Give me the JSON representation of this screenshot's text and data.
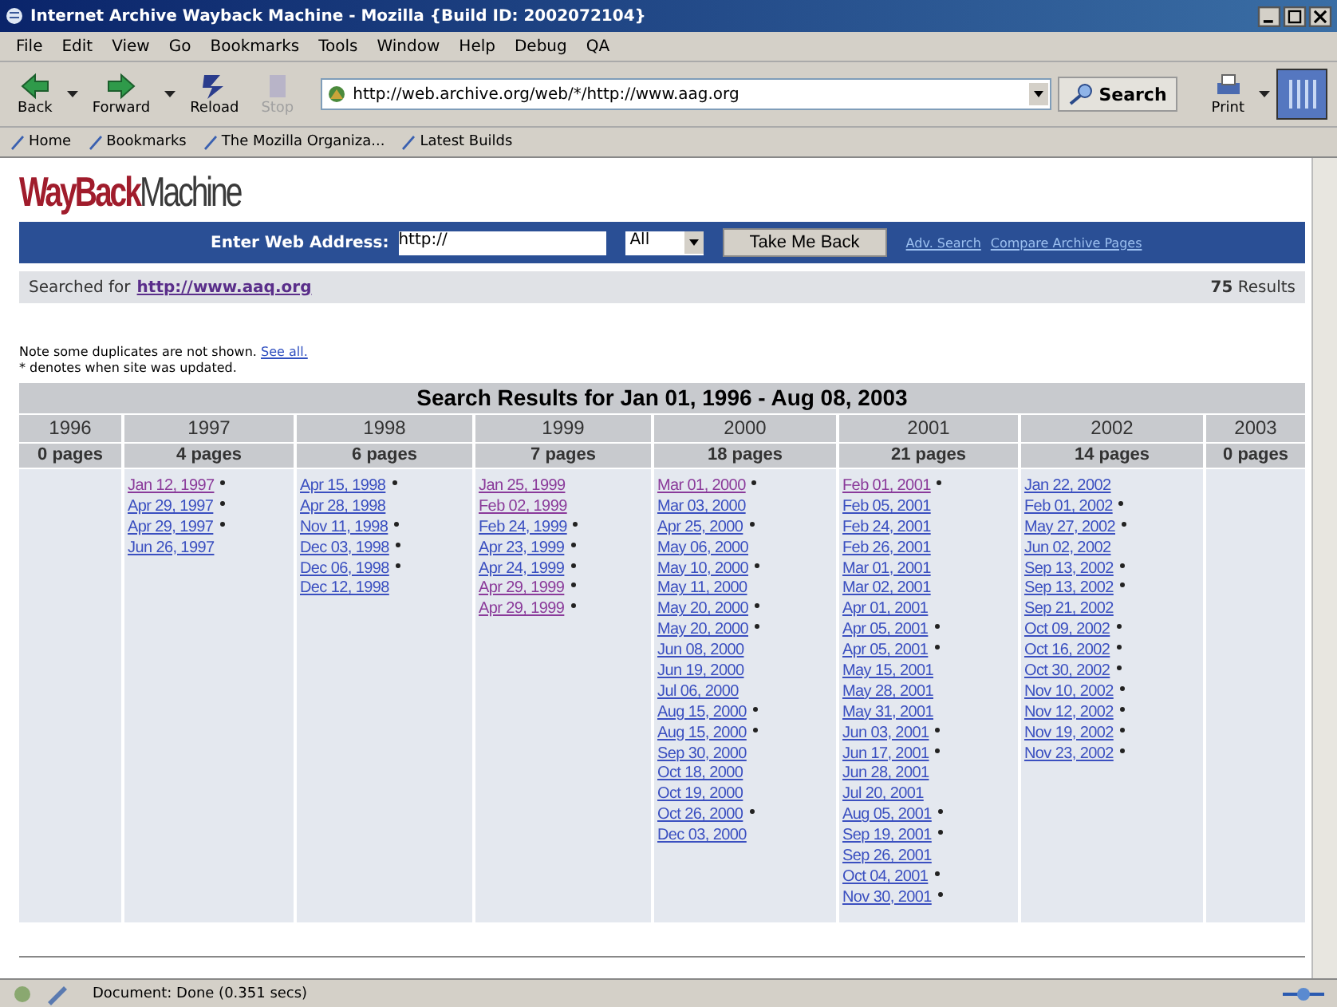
{
  "window": {
    "title": "Internet Archive Wayback Machine - Mozilla {Build ID: 2002072104}"
  },
  "menu": [
    "File",
    "Edit",
    "View",
    "Go",
    "Bookmarks",
    "Tools",
    "Window",
    "Help",
    "Debug",
    "QA"
  ],
  "toolbar": [
    {
      "label": "Back",
      "kind": "back",
      "disabled": false,
      "dropdown": true
    },
    {
      "label": "Forward",
      "kind": "forward",
      "disabled": false,
      "dropdown": true
    },
    {
      "label": "Reload",
      "kind": "reload",
      "disabled": false,
      "dropdown": false
    },
    {
      "label": "Stop",
      "kind": "stop",
      "disabled": true,
      "dropdown": false
    }
  ],
  "address": {
    "value": "http://web.archive.org/web/*/http://www.aag.org"
  },
  "search_button": "Search",
  "print_button": "Print",
  "bookmarks": [
    "Home",
    "Bookmarks",
    "The Mozilla Organiza...",
    "Latest Builds"
  ],
  "page": {
    "logo": {
      "first": "WayBack",
      "second": "Machine"
    },
    "form": {
      "label": "Enter Web Address:",
      "value": "http://",
      "select": "All",
      "button": "Take Me Back",
      "links": [
        "Adv. Search",
        "Compare Archive Pages"
      ]
    },
    "searched": {
      "prefix": "Searched for",
      "url": "http://www.aaq.org",
      "count": "75",
      "suffix": "Results"
    },
    "note": {
      "text": "Note some duplicates are not shown.",
      "link": "See all.",
      "legend": "* denotes when site was updated."
    },
    "results": {
      "title": "Search Results for Jan 01, 1996 - Aug 08, 2003",
      "years": [
        {
          "year": "1996",
          "pages": "0 pages"
        },
        {
          "year": "1997",
          "pages": "4 pages",
          "captures": [
            {
              "date": "Jan 12, 1997",
              "updated": true,
              "visited": true
            },
            {
              "date": "Apr 29, 1997",
              "updated": true,
              "visited": false
            },
            {
              "date": "Apr 29, 1997",
              "updated": true,
              "visited": false
            },
            {
              "date": "Jun 26, 1997",
              "updated": false,
              "visited": false
            }
          ]
        },
        {
          "year": "1998",
          "pages": "6 pages",
          "captures": [
            {
              "date": "Apr 15, 1998",
              "updated": true,
              "visited": false
            },
            {
              "date": "Apr 28, 1998",
              "updated": false,
              "visited": false
            },
            {
              "date": "Nov 11, 1998",
              "updated": true,
              "visited": false
            },
            {
              "date": "Dec 03, 1998",
              "updated": true,
              "visited": false
            },
            {
              "date": "Dec 06, 1998",
              "updated": true,
              "visited": false
            },
            {
              "date": "Dec 12, 1998",
              "updated": false,
              "visited": false
            }
          ]
        },
        {
          "year": "1999",
          "pages": "7 pages",
          "captures": [
            {
              "date": "Jan 25, 1999",
              "updated": false,
              "visited": true
            },
            {
              "date": "Feb 02, 1999",
              "updated": false,
              "visited": true
            },
            {
              "date": "Feb 24, 1999",
              "updated": true,
              "visited": false
            },
            {
              "date": "Apr 23, 1999",
              "updated": true,
              "visited": false
            },
            {
              "date": "Apr 24, 1999",
              "updated": true,
              "visited": false
            },
            {
              "date": "Apr 29, 1999",
              "updated": true,
              "visited": true
            },
            {
              "date": "Apr 29, 1999",
              "updated": true,
              "visited": true
            }
          ]
        },
        {
          "year": "2000",
          "pages": "18 pages",
          "captures": [
            {
              "date": "Mar 01, 2000",
              "updated": true,
              "visited": true
            },
            {
              "date": "Mar 03, 2000",
              "updated": false,
              "visited": false
            },
            {
              "date": "Apr 25, 2000",
              "updated": true,
              "visited": false
            },
            {
              "date": "May 06, 2000",
              "updated": false,
              "visited": false
            },
            {
              "date": "May 10, 2000",
              "updated": true,
              "visited": false
            },
            {
              "date": "May 11, 2000",
              "updated": false,
              "visited": false
            },
            {
              "date": "May 20, 2000",
              "updated": true,
              "visited": false
            },
            {
              "date": "May 20, 2000",
              "updated": true,
              "visited": false
            },
            {
              "date": "Jun 08, 2000",
              "updated": false,
              "visited": false
            },
            {
              "date": "Jun 19, 2000",
              "updated": false,
              "visited": false
            },
            {
              "date": "Jul 06, 2000",
              "updated": false,
              "visited": false
            },
            {
              "date": "Aug 15, 2000",
              "updated": true,
              "visited": false
            },
            {
              "date": "Aug 15, 2000",
              "updated": true,
              "visited": false
            },
            {
              "date": "Sep 30, 2000",
              "updated": false,
              "visited": false
            },
            {
              "date": "Oct 18, 2000",
              "updated": false,
              "visited": false
            },
            {
              "date": "Oct 19, 2000",
              "updated": false,
              "visited": false
            },
            {
              "date": "Oct 26, 2000",
              "updated": true,
              "visited": false
            },
            {
              "date": "Dec 03, 2000",
              "updated": false,
              "visited": false
            }
          ]
        },
        {
          "year": "2001",
          "pages": "21 pages",
          "captures": [
            {
              "date": "Feb 01, 2001",
              "updated": true,
              "visited": true
            },
            {
              "date": "Feb 05, 2001",
              "updated": false,
              "visited": false
            },
            {
              "date": "Feb 24, 2001",
              "updated": false,
              "visited": false
            },
            {
              "date": "Feb 26, 2001",
              "updated": false,
              "visited": false
            },
            {
              "date": "Mar 01, 2001",
              "updated": false,
              "visited": false
            },
            {
              "date": "Mar 02, 2001",
              "updated": false,
              "visited": false
            },
            {
              "date": "Apr 01, 2001",
              "updated": false,
              "visited": false
            },
            {
              "date": "Apr 05, 2001",
              "updated": true,
              "visited": false
            },
            {
              "date": "Apr 05, 2001",
              "updated": true,
              "visited": false
            },
            {
              "date": "May 15, 2001",
              "updated": false,
              "visited": false
            },
            {
              "date": "May 28, 2001",
              "updated": false,
              "visited": false
            },
            {
              "date": "May 31, 2001",
              "updated": false,
              "visited": false
            },
            {
              "date": "Jun 03, 2001",
              "updated": true,
              "visited": false
            },
            {
              "date": "Jun 17, 2001",
              "updated": true,
              "visited": false
            },
            {
              "date": "Jun 28, 2001",
              "updated": false,
              "visited": false
            },
            {
              "date": "Jul 20, 2001",
              "updated": false,
              "visited": false
            },
            {
              "date": "Aug 05, 2001",
              "updated": true,
              "visited": false
            },
            {
              "date": "Sep 19, 2001",
              "updated": true,
              "visited": false
            },
            {
              "date": "Sep 26, 2001",
              "updated": false,
              "visited": false
            },
            {
              "date": "Oct 04, 2001",
              "updated": true,
              "visited": false
            },
            {
              "date": "Nov 30, 2001",
              "updated": true,
              "visited": false
            }
          ]
        },
        {
          "year": "2002",
          "pages": "14 pages",
          "captures": [
            {
              "date": "Jan 22, 2002",
              "updated": false,
              "visited": false
            },
            {
              "date": "Feb 01, 2002",
              "updated": true,
              "visited": false
            },
            {
              "date": "May 27, 2002",
              "updated": true,
              "visited": false
            },
            {
              "date": "Jun 02, 2002",
              "updated": false,
              "visited": false
            },
            {
              "date": "Sep 13, 2002",
              "updated": true,
              "visited": false
            },
            {
              "date": "Sep 13, 2002",
              "updated": true,
              "visited": false
            },
            {
              "date": "Sep 21, 2002",
              "updated": false,
              "visited": false
            },
            {
              "date": "Oct 09, 2002",
              "updated": true,
              "visited": false
            },
            {
              "date": "Oct 16, 2002",
              "updated": true,
              "visited": false
            },
            {
              "date": "Oct 30, 2002",
              "updated": true,
              "visited": false
            },
            {
              "date": "Nov 10, 2002",
              "updated": true,
              "visited": false
            },
            {
              "date": "Nov 12, 2002",
              "updated": true,
              "visited": false
            },
            {
              "date": "Nov 19, 2002",
              "updated": true,
              "visited": false
            },
            {
              "date": "Nov 23, 2002",
              "updated": true,
              "visited": false
            }
          ]
        },
        {
          "year": "2003",
          "pages": "0 pages"
        }
      ]
    }
  },
  "status_bar": {
    "text": "Document: Done (0.351 secs)"
  }
}
